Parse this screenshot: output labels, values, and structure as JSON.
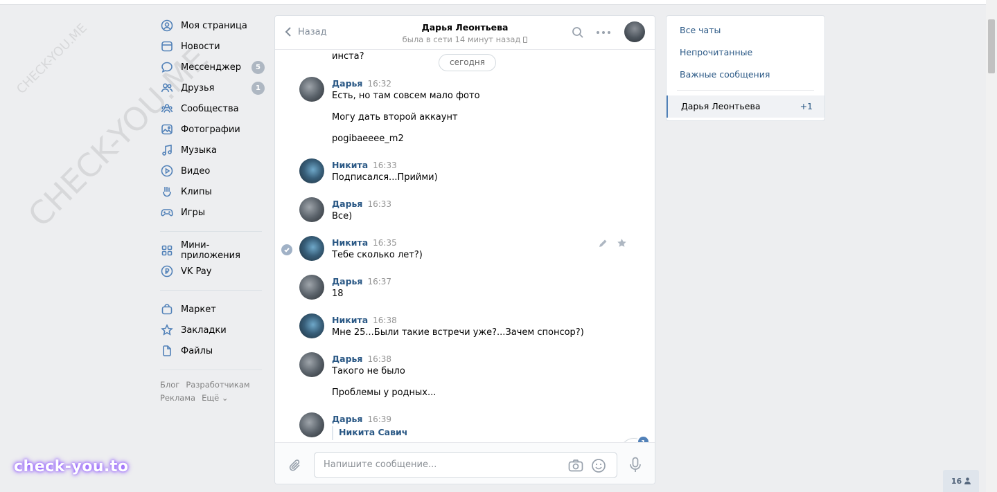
{
  "watermarks": {
    "small": "CHECK-YOU.ME",
    "large": "CHECK-YOU.ME",
    "brand": "check-you.to"
  },
  "nav": {
    "items": [
      {
        "label": "Моя страница",
        "icon": "user-circle-icon"
      },
      {
        "label": "Новости",
        "icon": "newspaper-icon"
      },
      {
        "label": "Мессенджер",
        "icon": "message-bubble-icon",
        "badge": "5"
      },
      {
        "label": "Друзья",
        "icon": "friends-icon",
        "badge": "1"
      },
      {
        "label": "Сообщества",
        "icon": "groups-icon"
      },
      {
        "label": "Фотографии",
        "icon": "photo-icon"
      },
      {
        "label": "Музыка",
        "icon": "music-note-icon"
      },
      {
        "label": "Видео",
        "icon": "play-circle-icon"
      },
      {
        "label": "Клипы",
        "icon": "clips-icon"
      },
      {
        "label": "Игры",
        "icon": "gamepad-icon"
      }
    ],
    "items2": [
      {
        "label": "Мини-приложения",
        "icon": "apps-grid-icon"
      },
      {
        "label": "VK Pay",
        "icon": "ruble-circle-icon"
      }
    ],
    "items3": [
      {
        "label": "Маркет",
        "icon": "shopping-bag-icon"
      },
      {
        "label": "Закладки",
        "icon": "star-icon"
      },
      {
        "label": "Файлы",
        "icon": "file-icon"
      }
    ],
    "footer": {
      "blog": "Блог",
      "devs": "Разработчикам",
      "ads": "Реклама",
      "more": "Ещё ⌄"
    }
  },
  "chat": {
    "back_label": "Назад",
    "title": "Дарья Леонтьева",
    "status": "была в сети 14 минут назад",
    "date_pill": "сегодня",
    "partial_text": "инста?",
    "messages": [
      {
        "author": "Дарья",
        "time": "16:32",
        "lines": [
          "Есть, но там совсем мало фото",
          "Могу дать второй аккаунт",
          "pogibaeeee_m2"
        ]
      },
      {
        "author": "Никита",
        "time": "16:33",
        "lines": [
          "Подписался...Прийми)"
        ]
      },
      {
        "author": "Дарья",
        "time": "16:33",
        "lines": [
          "Все)"
        ]
      },
      {
        "author": "Никита",
        "time": "16:35",
        "lines": [
          "Тебе сколько лет?)"
        ]
      },
      {
        "author": "Дарья",
        "time": "16:37",
        "lines": [
          "18"
        ]
      },
      {
        "author": "Никита",
        "time": "16:38",
        "lines": [
          "Мне 25...Были такие встречи уже?...Зачем спонсор?)"
        ]
      },
      {
        "author": "Дарья",
        "time": "16:38",
        "lines": [
          "Такого не было",
          "Проблемы у родных..."
        ]
      },
      {
        "author": "Дарья",
        "time": "16:39",
        "forwarded_from": "Никита Савич"
      }
    ],
    "unread_count": "1",
    "composer_placeholder": "Напишите сообщение..."
  },
  "right_panel": {
    "all_chats": "Все чаты",
    "unread": "Непрочитанные",
    "important": "Важные сообщения",
    "active_chat": "Дарья Леонтьева",
    "active_count": "+1"
  },
  "online_count": "16",
  "colors": {
    "accent": "#5181b8",
    "link": "#2a5885",
    "background": "#edeef0"
  }
}
